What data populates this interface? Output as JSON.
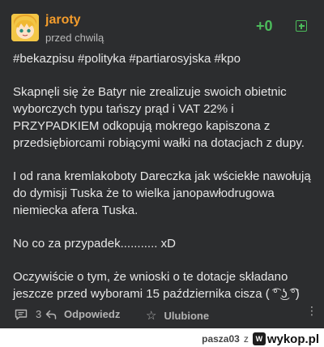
{
  "post": {
    "author": "jaroty",
    "time": "przed chwilą",
    "score": "+0",
    "tags": "#bekazpisu #polityka #partiarosyjska #kpo",
    "paragraphs": [
      "Skapnęli się że Batyr nie zrealizuje swoich obietnic wyborczych typu tańszy prąd i VAT 22% i PRZYPADKIEM odkopują mokrego kapiszona z przedsiębiorcami robiącymi wałki na dotacjach z dupy.",
      "I od rana kremlakoboty Dareczka jak wściekłe nawołują do dymisji Tuska że to wielka janopawłodrugowa niemiecka afera Tuska.",
      "No co za przypadek........... xD",
      "Oczywiście o tym, że wnioski o te dotacje składano jeszcze przed wyborami 15 października cisza ( ͡° ͜ʖ ͡°)"
    ]
  },
  "footer": {
    "comments_count": "3",
    "reply_label": "Odpowiedz",
    "favorite_label": "Ulubione"
  },
  "watermark": {
    "user": "pasza03",
    "connector": "z",
    "brand": "wykop.pl"
  },
  "colors": {
    "card_bg": "#2c2d2f",
    "author": "#f39c2c",
    "vote_green": "#4cbb5b"
  }
}
